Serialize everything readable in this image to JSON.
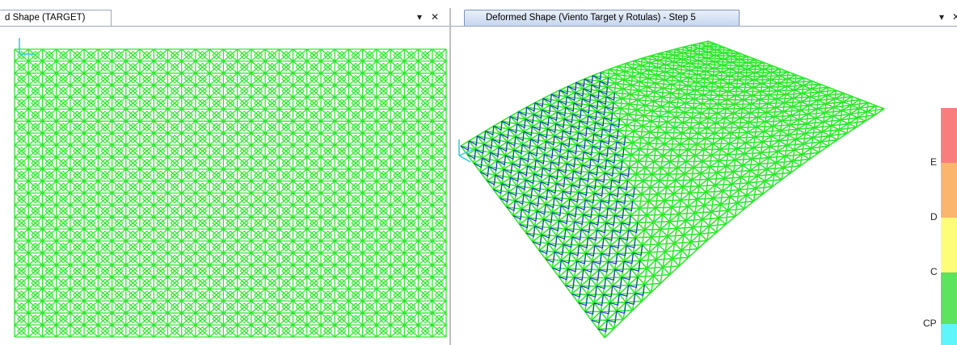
{
  "left_pane": {
    "tab_title": "d Shape (TARGET)",
    "dropdown_icon": "▾",
    "close_icon": "✕"
  },
  "right_pane": {
    "tab_title": "Deformed Shape (Viento Target y Rotulas) - Step 5",
    "dropdown_icon": "▾",
    "close_icon": "✕"
  },
  "legend": {
    "labels": [
      "E",
      "D",
      "C",
      "CP"
    ],
    "colors": [
      "#fa7d7d",
      "#fbb56c",
      "#fdfd7a",
      "#5de35d",
      "#5ef6fb"
    ]
  },
  "colors": {
    "mesh_green": "#2ee82e",
    "member_blue": "#1a2acc",
    "axis_cyan": "#2fc4e8"
  }
}
